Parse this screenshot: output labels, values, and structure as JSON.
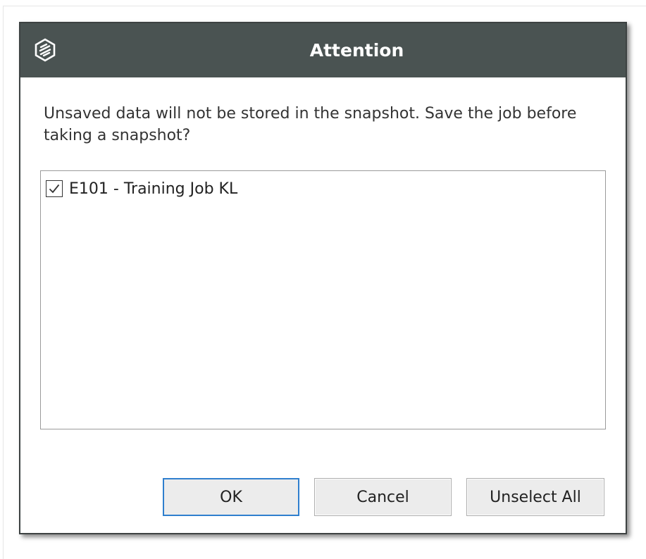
{
  "dialog": {
    "title": "Attention",
    "icon": "app-logo-icon",
    "message": "Unsaved data will not be stored in the snapshot. Save the job before taking a snapshot?",
    "items": [
      {
        "label": "E101 - Training Job KL",
        "checked": true
      }
    ],
    "buttons": {
      "ok_label": "OK",
      "cancel_label": "Cancel",
      "unselect_all_label": "Unselect All"
    },
    "colors": {
      "titlebar": "#4a5352",
      "focus_border": "#2f7fce"
    }
  }
}
